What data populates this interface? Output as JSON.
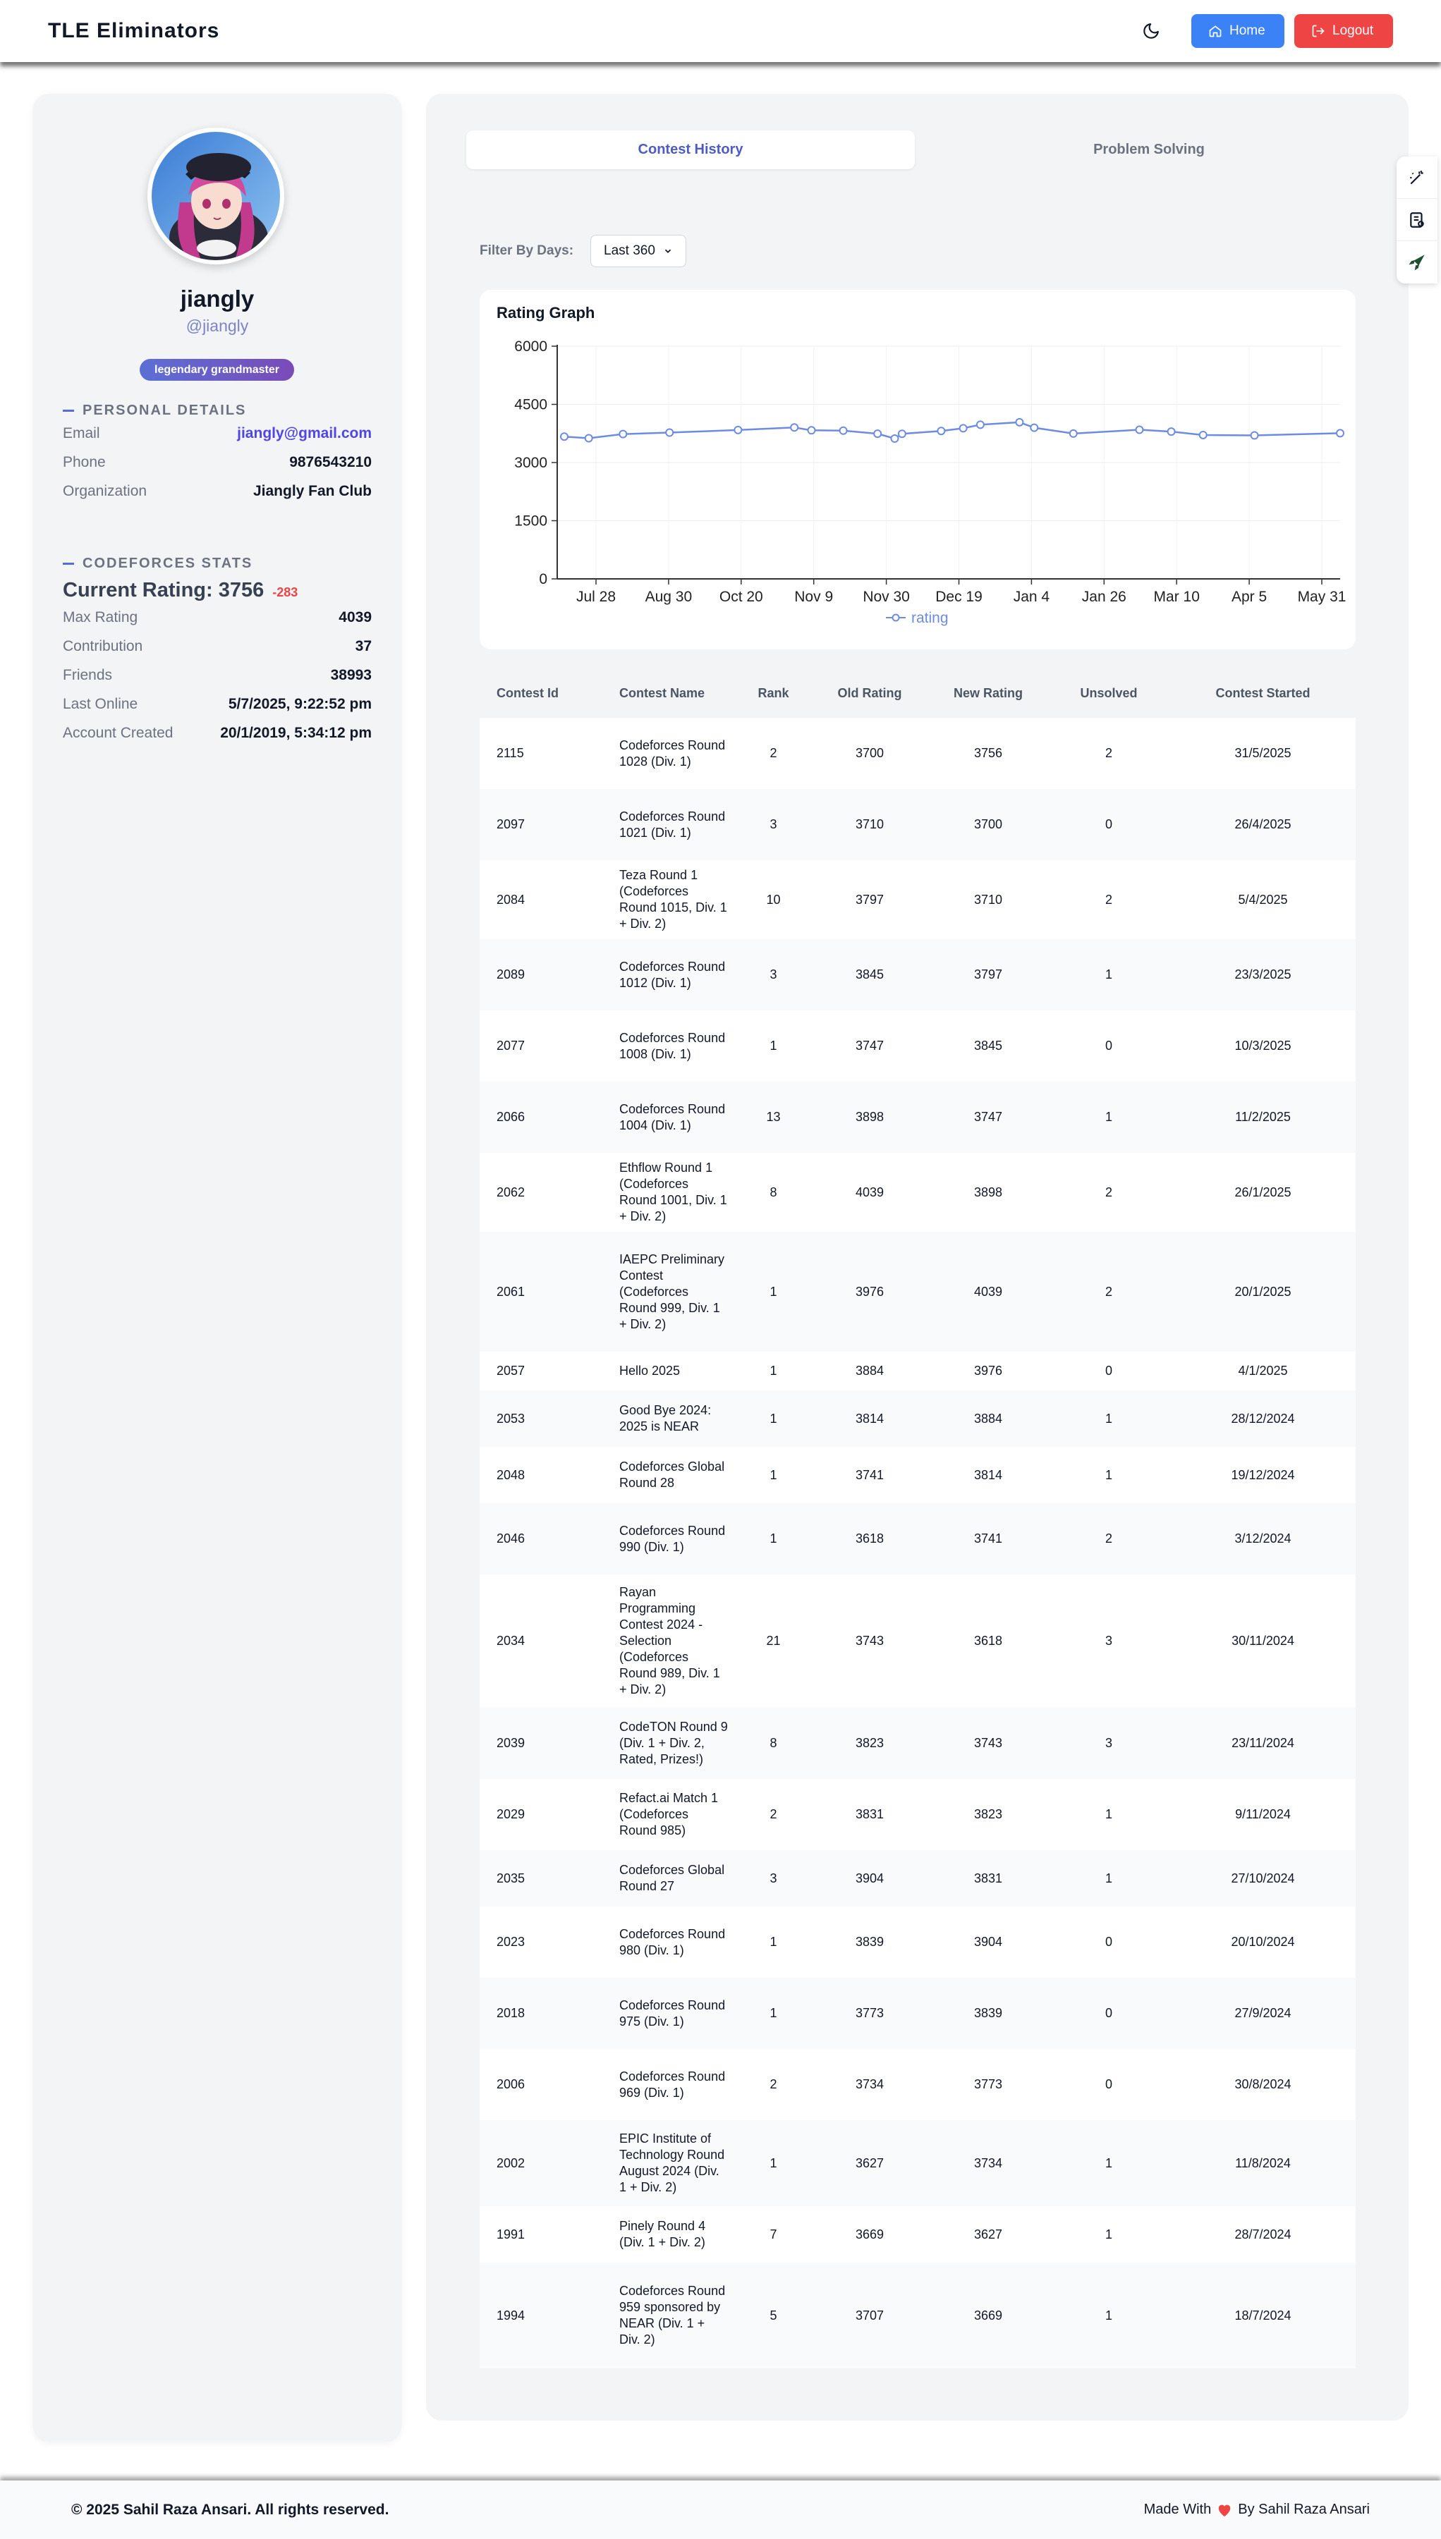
{
  "header": {
    "brand": "TLE Eliminators",
    "home_label": "Home",
    "logout_label": "Logout"
  },
  "profile": {
    "name": "jiangly",
    "handle": "@jiangly",
    "rank_badge": "legendary grandmaster",
    "personal_title": "PERSONAL DETAILS",
    "email_label": "Email",
    "email": "jiangly@gmail.com",
    "phone_label": "Phone",
    "phone": "9876543210",
    "org_label": "Organization",
    "org": "Jiangly Fan Club",
    "cf_title": "CODEFORCES STATS",
    "current_rating": "Current Rating: 3756",
    "rating_delta": "-283",
    "max_label": "Max Rating",
    "max": "4039",
    "contrib_label": "Contribution",
    "contrib": "37",
    "friends_label": "Friends",
    "friends": "38993",
    "online_label": "Last Online",
    "online": "5/7/2025, 9:22:52 pm",
    "created_label": "Account Created",
    "created": "20/1/2019, 5:34:12 pm"
  },
  "tabs": {
    "active": "Contest History",
    "other": "Problem Solving"
  },
  "filter": {
    "label": "Filter By Days:",
    "value": "Last 360"
  },
  "chart_data": {
    "type": "line",
    "title": "Rating Graph",
    "x_tick_labels": [
      "Jul 28",
      "Aug 30",
      "Oct 20",
      "Nov 9",
      "Nov 30",
      "Dec 19",
      "Jan 4",
      "Jan 26",
      "Mar 10",
      "Apr 5",
      "May 31"
    ],
    "y_ticks": [
      0,
      1500,
      3000,
      4500,
      6000
    ],
    "ylim": [
      0,
      6000
    ],
    "x": [
      "18/7/2024",
      "28/7/2024",
      "11/8/2024",
      "30/8/2024",
      "27/9/2024",
      "20/10/2024",
      "27/10/2024",
      "9/11/2024",
      "23/11/2024",
      "30/11/2024",
      "3/12/2024",
      "19/12/2024",
      "28/12/2024",
      "4/1/2025",
      "20/1/2025",
      "26/1/2025",
      "11/2/2025",
      "10/3/2025",
      "23/3/2025",
      "5/4/2025",
      "26/4/2025",
      "31/5/2025"
    ],
    "series": [
      {
        "name": "rating",
        "values": [
          3669,
          3627,
          3734,
          3773,
          3839,
          3904,
          3831,
          3823,
          3743,
          3618,
          3741,
          3814,
          3884,
          3976,
          4039,
          3898,
          3747,
          3845,
          3797,
          3710,
          3700,
          3756
        ]
      }
    ],
    "grid": true,
    "legend": "bottom-center",
    "color": "#6d8be3"
  },
  "table": {
    "headers": [
      "Contest Id",
      "Contest Name",
      "Rank",
      "Old Rating",
      "New Rating",
      "Unsolved",
      "Contest Started"
    ],
    "rows": [
      [
        "2115",
        "Codeforces Round 1028 (Div. 1)",
        "2",
        "3700",
        "3756",
        "2",
        "31/5/2025"
      ],
      [
        "2097",
        "Codeforces Round 1021 (Div. 1)",
        "3",
        "3710",
        "3700",
        "0",
        "26/4/2025"
      ],
      [
        "2084",
        "Teza Round 1 (Codeforces Round 1015, Div. 1 + Div. 2)",
        "10",
        "3797",
        "3710",
        "2",
        "5/4/2025"
      ],
      [
        "2089",
        "Codeforces Round 1012 (Div. 1)",
        "3",
        "3845",
        "3797",
        "1",
        "23/3/2025"
      ],
      [
        "2077",
        "Codeforces Round 1008 (Div. 1)",
        "1",
        "3747",
        "3845",
        "0",
        "10/3/2025"
      ],
      [
        "2066",
        "Codeforces Round 1004 (Div. 1)",
        "13",
        "3898",
        "3747",
        "1",
        "11/2/2025"
      ],
      [
        "2062",
        "Ethflow Round 1 (Codeforces Round 1001, Div. 1 + Div. 2)",
        "8",
        "4039",
        "3898",
        "2",
        "26/1/2025"
      ],
      [
        "2061",
        "IAEPC Preliminary Contest (Codeforces Round 999, Div. 1 + Div. 2)",
        "1",
        "3976",
        "4039",
        "2",
        "20/1/2025"
      ],
      [
        "2057",
        "Hello 2025",
        "1",
        "3884",
        "3976",
        "0",
        "4/1/2025"
      ],
      [
        "2053",
        "Good Bye 2024: 2025 is NEAR",
        "1",
        "3814",
        "3884",
        "1",
        "28/12/2024"
      ],
      [
        "2048",
        "Codeforces Global Round 28",
        "1",
        "3741",
        "3814",
        "1",
        "19/12/2024"
      ],
      [
        "2046",
        "Codeforces Round 990 (Div. 1)",
        "1",
        "3618",
        "3741",
        "2",
        "3/12/2024"
      ],
      [
        "2034",
        "Rayan Programming Contest 2024 - Selection (Codeforces Round 989, Div. 1 + Div. 2)",
        "21",
        "3743",
        "3618",
        "3",
        "30/11/2024"
      ],
      [
        "2039",
        "CodeTON Round 9 (Div. 1 + Div. 2, Rated, Prizes!)",
        "8",
        "3823",
        "3743",
        "3",
        "23/11/2024"
      ],
      [
        "2029",
        "Refact.ai Match 1 (Codeforces Round 985)",
        "2",
        "3831",
        "3823",
        "1",
        "9/11/2024"
      ],
      [
        "2035",
        "Codeforces Global Round 27",
        "3",
        "3904",
        "3831",
        "1",
        "27/10/2024"
      ],
      [
        "2023",
        "Codeforces Round 980 (Div. 1)",
        "1",
        "3839",
        "3904",
        "0",
        "20/10/2024"
      ],
      [
        "2018",
        "Codeforces Round 975 (Div. 1)",
        "1",
        "3773",
        "3839",
        "0",
        "27/9/2024"
      ],
      [
        "2006",
        "Codeforces Round 969 (Div. 1)",
        "2",
        "3734",
        "3773",
        "0",
        "30/8/2024"
      ],
      [
        "2002",
        "EPIC Institute of Technology Round August 2024 (Div. 1 + Div. 2)",
        "1",
        "3627",
        "3734",
        "1",
        "11/8/2024"
      ],
      [
        "1991",
        "Pinely Round 4 (Div. 1 + Div. 2)",
        "7",
        "3669",
        "3627",
        "1",
        "28/7/2024"
      ],
      [
        "1994",
        "Codeforces Round 959 sponsored by NEAR (Div. 1 + Div. 2)",
        "5",
        "3707",
        "3669",
        "1",
        "18/7/2024"
      ]
    ]
  },
  "footer": {
    "copyright": "© 2025 Sahil Raza Ansari. All rights reserved.",
    "made_with": "Made With",
    "by": "By Sahil Raza Ansari"
  },
  "icons": {
    "theme": "moon-icon",
    "home": "home-icon",
    "logout": "logout-icon",
    "heart": "heart-icon"
  }
}
